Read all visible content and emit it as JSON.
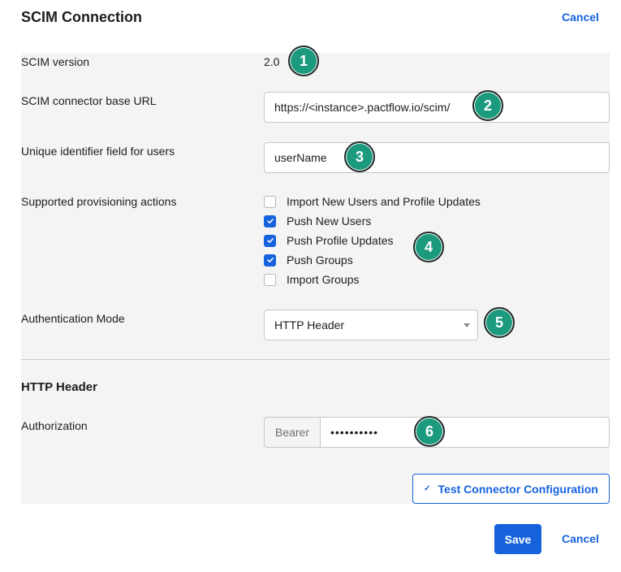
{
  "header": {
    "title": "SCIM Connection",
    "cancel_label": "Cancel"
  },
  "fields": {
    "scim_version": {
      "label": "SCIM version",
      "value": "2.0"
    },
    "base_url": {
      "label": "SCIM connector base URL",
      "value": "https://<instance>.pactflow.io/scim/"
    },
    "unique_id": {
      "label": "Unique identifier field for users",
      "value": "userName"
    },
    "provisioning": {
      "label": "Supported provisioning actions",
      "options": [
        {
          "label": "Import New Users and Profile Updates",
          "checked": false
        },
        {
          "label": "Push New Users",
          "checked": true
        },
        {
          "label": "Push Profile Updates",
          "checked": true
        },
        {
          "label": "Push Groups",
          "checked": true
        },
        {
          "label": "Import Groups",
          "checked": false
        }
      ]
    },
    "auth_mode": {
      "label": "Authentication Mode",
      "selected": "HTTP Header"
    }
  },
  "http_header": {
    "heading": "HTTP Header",
    "authorization": {
      "label": "Authorization",
      "prefix": "Bearer",
      "value": "••••••••••"
    }
  },
  "actions": {
    "test_label": "Test Connector Configuration",
    "save_label": "Save",
    "cancel_label": "Cancel"
  },
  "annotations": [
    "1",
    "2",
    "3",
    "4",
    "5",
    "6"
  ],
  "colors": {
    "accent": "#1662dd",
    "panel": "#f4f4f4",
    "badge": "#1b9a7e"
  }
}
